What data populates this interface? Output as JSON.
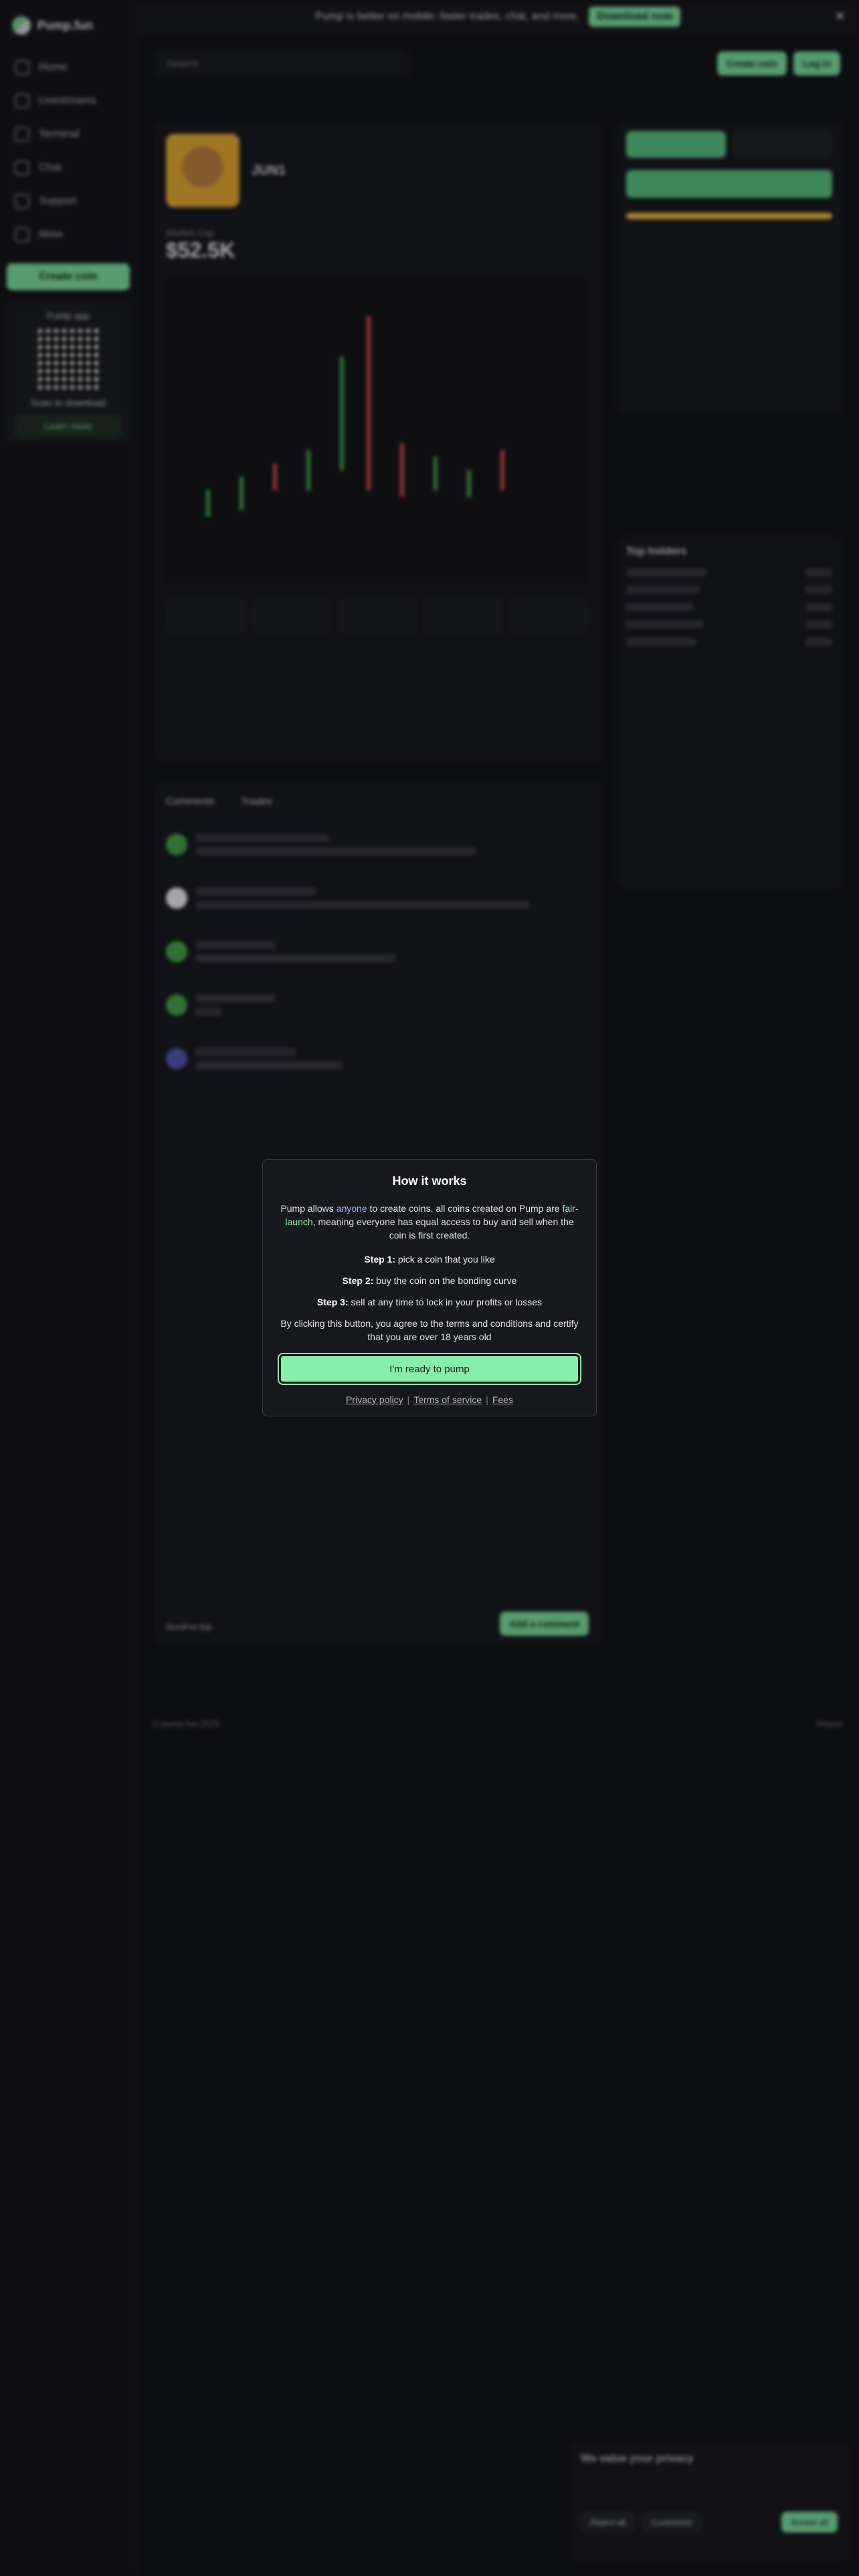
{
  "sidebar": {
    "brand": "Pump.fun",
    "items": [
      {
        "label": "Home"
      },
      {
        "label": "Livestreams"
      },
      {
        "label": "Terminal"
      },
      {
        "label": "Chat"
      },
      {
        "label": "Support"
      },
      {
        "label": "More"
      }
    ],
    "create_label": "Create coin",
    "app_title": "Pump app",
    "app_sub": "Scan to download",
    "learn_label": "Learn more"
  },
  "banner": {
    "text": "Pump is better on mobile: faster trades, chat, and more.",
    "download_label": "Download now"
  },
  "topbar": {
    "search_placeholder": "Search",
    "create_label": "Create coin",
    "login_label": "Log in"
  },
  "coin": {
    "name": "JUN1",
    "mcap_label": "Market Cap",
    "mcap_value": "$52.5K"
  },
  "comments": {
    "tab_comments": "Comments",
    "tab_trades": "Trades",
    "scroll_label": "Scroll to top",
    "add_label": "Add a comment"
  },
  "holders": {
    "title": "Top holders"
  },
  "footer": {
    "copyright": "© pump.fun 2025",
    "report": "Report"
  },
  "privacy": {
    "title": "We value your privacy",
    "reject": "Reject all",
    "customize": "Customize",
    "accept": "Accept all"
  },
  "modal": {
    "title": "How it works",
    "intro_1": "Pump allows ",
    "intro_anyone": "anyone",
    "intro_2": " to create coins. all coins created on Pump are ",
    "intro_fair": "fair-launch",
    "intro_3": ", meaning everyone has equal access to buy and sell when the coin is first created.",
    "step1_label": "Step 1:",
    "step1_text": " pick a coin that you like",
    "step2_label": "Step 2:",
    "step2_text": " buy the coin on the bonding curve",
    "step3_label": "Step 3:",
    "step3_text": " sell at any time to lock in your profits or losses",
    "terms": "By clicking this button, you agree to the terms and conditions and certify that you are over 18 years old",
    "ready_label": "I'm ready to pump",
    "link_privacy": "Privacy policy",
    "link_terms": "Terms of service",
    "link_fees": "Fees"
  }
}
